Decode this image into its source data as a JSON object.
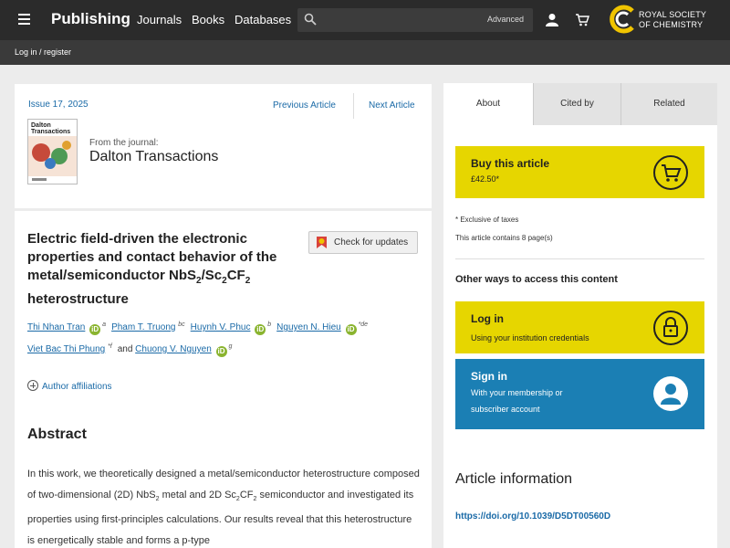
{
  "header": {
    "brand": "Publishing",
    "nav": [
      "Journals",
      "Books",
      "Databases"
    ],
    "search_placeholder": "",
    "advanced": "Advanced",
    "org_line1": "ROYAL SOCIETY",
    "org_line2": "OF CHEMISTRY",
    "login": "Log in / register"
  },
  "journal": {
    "issue": "Issue 17, 2025",
    "previous": "Previous Article",
    "next": "Next Article",
    "from": "From the journal:",
    "name": "Dalton Transactions",
    "cover_title_1": "Dalton",
    "cover_title_2": "Transactions"
  },
  "article": {
    "title_1": "Electric field-driven the electronic properties and contact behavior of the metal/semiconductor NbS",
    "title_sub1": "2",
    "title_2": "/Sc",
    "title_sub2": "2",
    "title_3": "CF",
    "title_sub3": "2",
    "title_4": " heterostructure",
    "check_updates": "Check for updates",
    "authors_row1": [
      {
        "name": "Thi Nhan Tran",
        "orcid": true,
        "sup": "a"
      },
      {
        "name": "Pham T. Truong",
        "orcid": false,
        "sup": "bc"
      },
      {
        "name": "Huynh V. Phuc",
        "orcid": true,
        "sup": "b"
      },
      {
        "name": "Nguyen N. Hieu",
        "orcid": true,
        "sup": "*de"
      }
    ],
    "authors_row2": [
      {
        "name": "Viet Bac Thi Phung",
        "orcid": false,
        "sup": "*f"
      },
      {
        "name": "Chuong V. Nguyen",
        "orcid": true,
        "sup": "g"
      }
    ],
    "and": "and",
    "affiliations": "Author affiliations",
    "abstract_heading": "Abstract",
    "abstract_1": "In this work, we theoretically designed a metal/semiconductor heterostructure composed of two-dimensional (2D) NbS",
    "abstract_2": " metal and 2D Sc",
    "abstract_3": "CF",
    "abstract_4": " semiconductor and investigated its properties using first-principles calculations. Our results reveal that this heterostructure is energetically stable and forms a p-type"
  },
  "sidebar": {
    "tabs": [
      "About",
      "Cited by",
      "Related"
    ],
    "buy_title": "Buy this article",
    "price": "£42.50*",
    "tax": "* Exclusive of taxes",
    "pages": "This article contains 8 page(s)",
    "other_ways": "Other ways to access this content",
    "login_title": "Log in",
    "login_sub": "Using your institution credentials",
    "signin_title": "Sign in",
    "signin_sub": "With your membership or subscriber account",
    "info_heading": "Article information",
    "doi": "https://doi.org/10.1039/D5DT00560D"
  },
  "colors": {
    "accent_yellow": "#e6d600",
    "link_blue": "#1a6aa7",
    "signin_blue": "#1b7fb4",
    "topbar": "#2b2b2b"
  }
}
